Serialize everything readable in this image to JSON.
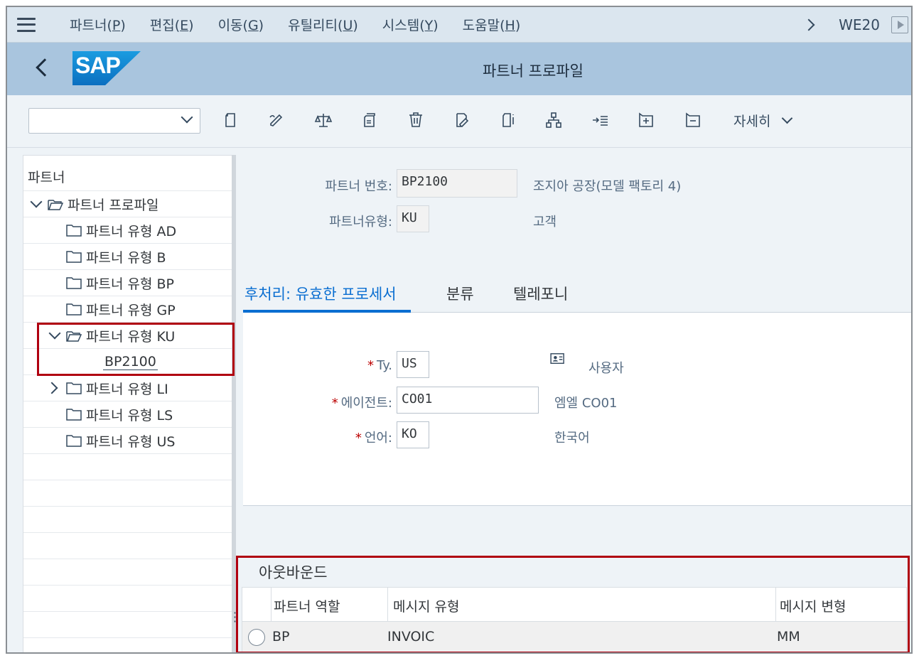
{
  "menubar": {
    "items": [
      {
        "label": "파트너(",
        "key": "P",
        "tail": ")"
      },
      {
        "label": "편집(",
        "key": "E",
        "tail": ")"
      },
      {
        "label": "이동(",
        "key": "G",
        "tail": ")"
      },
      {
        "label": "유틸리티(",
        "key": "U",
        "tail": ")"
      },
      {
        "label": "시스템(",
        "key": "Y",
        "tail": ")"
      },
      {
        "label": "도움말(",
        "key": "H",
        "tail": ")"
      }
    ],
    "tcode": "WE20"
  },
  "header": {
    "logo_text": "SAP",
    "title": "파트너 프로파일"
  },
  "toolbar": {
    "select_value": "",
    "icons": [
      "new-document-icon",
      "edit-pen-icon",
      "compare-scale-icon",
      "copy-icon",
      "delete-trash-icon",
      "change-icon",
      "info-icon",
      "hierarchy-icon",
      "expand-list-icon",
      "add-row-icon",
      "remove-row-icon"
    ],
    "more_label": "자세히"
  },
  "tree": {
    "header": "파트너",
    "root": "파트너 프로파일",
    "items": [
      {
        "label": "파트너 유형 AD"
      },
      {
        "label": "파트너 유형 B"
      },
      {
        "label": "파트너 유형 BP"
      },
      {
        "label": "파트너 유형 GP"
      },
      {
        "label": "파트너 유형 KU"
      },
      {
        "label": "BP2100"
      },
      {
        "label": "파트너 유형 LI"
      },
      {
        "label": "파트너 유형 LS"
      },
      {
        "label": "파트너 유형 US"
      }
    ]
  },
  "partner": {
    "number_label": "파트너 번호:",
    "number_value": "BP2100",
    "number_desc": "조지아 공장(모델 팩토리 4)",
    "type_label": "파트너유형:",
    "type_value": "KU",
    "type_desc": "고객"
  },
  "tabs": [
    "후처리: 유효한 프로세서",
    "분류",
    "텔레포니"
  ],
  "post_processing": {
    "ty_label": "Ty.",
    "ty_value": "US",
    "ty_desc": "사용자",
    "agent_label": "에이전트:",
    "agent_value": "CO01",
    "agent_desc": "엠엘 CO01",
    "lang_label": "언어:",
    "lang_value": "KO",
    "lang_desc": "한국어",
    "required_mark": "*"
  },
  "outbound": {
    "title": "아웃바운드",
    "columns": [
      "파트너 역할",
      "메시지 유형",
      "메시지 변형"
    ],
    "rows": [
      {
        "role": "BP",
        "message_type": "INVOIC",
        "variant": "MM"
      }
    ]
  }
}
